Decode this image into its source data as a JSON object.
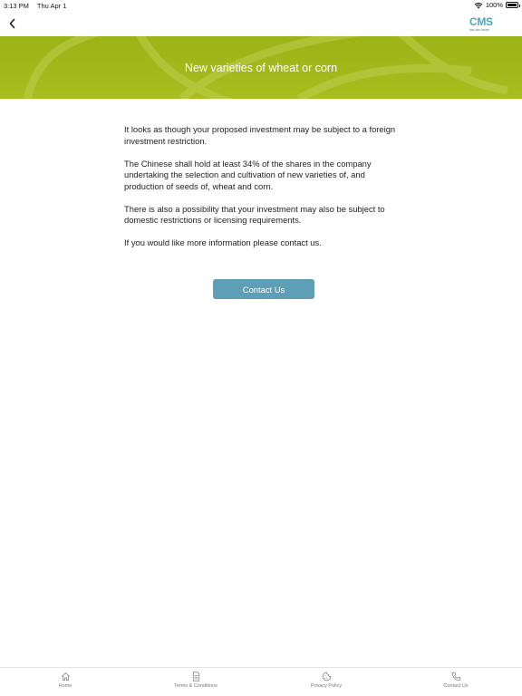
{
  "status_bar": {
    "time": "3:13 PM",
    "date": "Thu Apr 1",
    "battery": "100%",
    "icons": [
      "wifi-icon",
      "battery-icon"
    ]
  },
  "nav": {
    "back_icon": "chevron-left-icon",
    "logo": {
      "mark": "CMS",
      "tagline": "law-tax-future"
    }
  },
  "hero": {
    "title": "New varieties of wheat or corn",
    "color": "#a3b81a"
  },
  "content": {
    "paragraphs": [
      "It looks as though your proposed investment may be subject to a foreign investment restriction.",
      "The Chinese shall hold at least 34% of the shares in the company undertaking the selection and cultivation of new varieties of, and production of seeds of, wheat and corn.",
      "There is also a possibility that your investment may also be subject to domestic restrictions or licensing requirements.",
      "If you would like more information please contact us."
    ]
  },
  "contact_button": {
    "label": "Contact Us",
    "color": "#5c9fb6"
  },
  "tab_bar": {
    "tabs": [
      {
        "label": "Home",
        "icon": "home-icon"
      },
      {
        "label": "Terms & Conditions",
        "icon": "document-icon"
      },
      {
        "label": "Privacy Policy",
        "icon": "cookie-icon"
      },
      {
        "label": "Contact Us",
        "icon": "phone-icon"
      }
    ]
  }
}
